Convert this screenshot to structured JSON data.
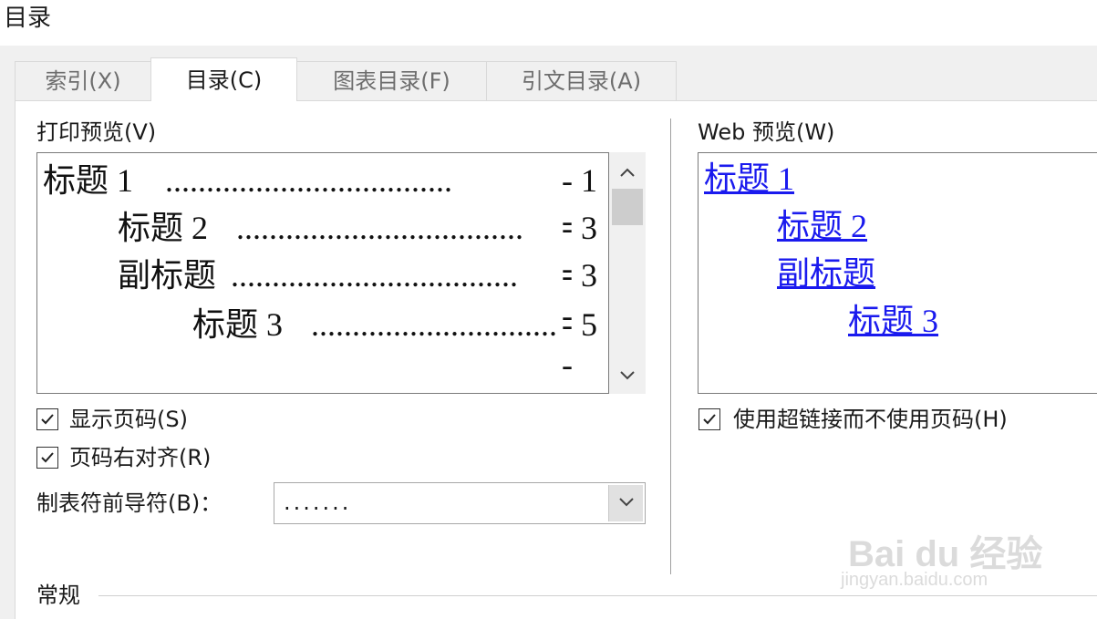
{
  "window": {
    "title": "目录"
  },
  "tabs": [
    {
      "label": "索引(X)",
      "active": false
    },
    {
      "label": "目录(C)",
      "active": true
    },
    {
      "label": "图表目录(F)",
      "active": false
    },
    {
      "label": "引文目录(A)",
      "active": false
    }
  ],
  "print_preview": {
    "label": "打印预览(V)",
    "entries": [
      {
        "text": "标题 1",
        "leader": "...................................",
        "page": "- 1 -"
      },
      {
        "text": "标题 2",
        "leader": "...................................",
        "page": "- 3 -"
      },
      {
        "text": "副标题",
        "leader": "...................................",
        "page": "- 3 -"
      },
      {
        "text": "标题 3",
        "leader": "...................................",
        "page": "- 5 -"
      }
    ]
  },
  "web_preview": {
    "label": "Web 预览(W)",
    "links": [
      "标题 1",
      "标题 2",
      "副标题",
      "标题 3"
    ]
  },
  "options": {
    "show_page_numbers": {
      "label": "显示页码(S)",
      "checked": true
    },
    "right_align": {
      "label": "页码右对齐(R)",
      "checked": true
    },
    "use_hyperlinks": {
      "label": "使用超链接而不使用页码(H)",
      "checked": true
    },
    "tab_leader": {
      "label": "制表符前导符(B)：",
      "value": "......."
    }
  },
  "general": {
    "label": "常规"
  },
  "watermark": {
    "text": "Bai du 经验",
    "sub": "jingyan.baidu.com"
  },
  "colors": {
    "link": "#1a1aee",
    "panel": "#ffffff",
    "background": "#f0f0f0"
  }
}
